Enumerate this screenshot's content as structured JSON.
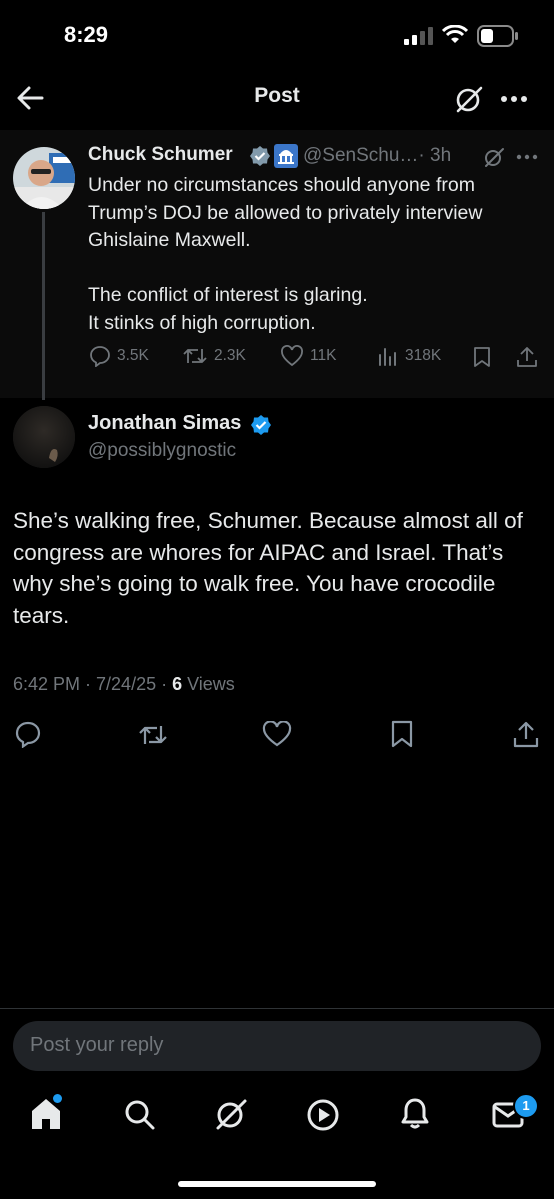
{
  "status_bar": {
    "time": "8:29"
  },
  "header": {
    "title": "Post"
  },
  "parent_post": {
    "name": "Chuck Schumer",
    "handle": "@SenSchu…",
    "time": "· 3h",
    "text": "Under no circumstances should anyone from Trump’s DOJ be allowed to privately interview Ghislaine Maxwell.\n\nThe conflict of interest is glaring.\nIt stinks of high corruption.",
    "stats": {
      "replies": "3.5K",
      "reposts": "2.3K",
      "likes": "11K",
      "views": "318K"
    }
  },
  "reply_post": {
    "name": "Jonathan Simas",
    "handle": "@possiblygnostic",
    "text": "She’s walking free, Schumer. Because almost all of congress are whores for AIPAC and Israel. That’s why she’s going to walk free. You have crocodile tears.",
    "timestamp": "6:42 PM · 7/24/25 · ",
    "views_count": "6",
    "views_label": " Views"
  },
  "composer": {
    "placeholder": "Post your reply"
  },
  "tab_bar": {
    "messages_badge": "1"
  },
  "colors": {
    "accent": "#1d9bf0",
    "muted": "#71767b",
    "text": "#e7e9ea",
    "background": "#000000"
  },
  "icons": [
    "back-arrow-icon",
    "grok-icon",
    "more-icon",
    "verified-icon",
    "capitol-icon",
    "reply-icon",
    "repost-icon",
    "like-icon",
    "views-icon",
    "bookmark-icon",
    "share-icon",
    "home-icon",
    "search-icon",
    "play-icon",
    "bell-icon",
    "mail-icon"
  ]
}
